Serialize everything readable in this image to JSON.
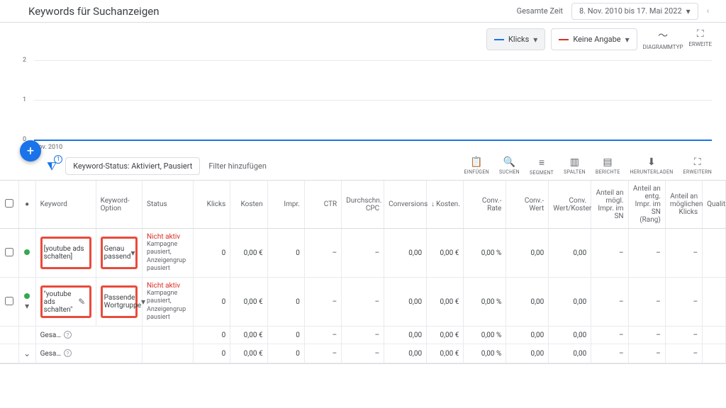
{
  "header": {
    "title": "Keywords für Suchanzeigen",
    "timeframe_label": "Gesamte Zeit",
    "daterange": "8. Nov. 2010 bis 17. Mai 2022"
  },
  "chart": {
    "series1_label": "Klicks",
    "series2_label": "Keine Angabe",
    "diagrammtyp": "DIAGRAMMTYP",
    "erweitern": "ERWEITE",
    "y": [
      "0",
      "1",
      "2"
    ],
    "x_start": "Nov. 2010"
  },
  "filters": {
    "badge": "1",
    "chip": "Keyword-Status: Aktiviert, Pausiert",
    "add": "Filter hinzufügen"
  },
  "tools": {
    "einfugen": "EINFÜGEN",
    "suchen": "SUCHEN",
    "segment": "SEGMENT",
    "spalten": "SPALTEN",
    "berichte": "BERICHTE",
    "herunterladen": "HERUNTERLADEN",
    "erweitern": "ERWEITERN"
  },
  "columns": [
    "Keyword",
    "Keyword-Option",
    "Status",
    "Klicks",
    "Kosten",
    "Impr.",
    "CTR",
    "Durchschn. CPC",
    "Conversions",
    "Kosten.",
    "Conv.-Rate",
    "Conv.-Wert",
    "Conv. Wert/Koster",
    "Anteil an mögl. Impr. im SN",
    "Anteil an entg. Impr. im SN (Rang)",
    "Anteil an möglichen Klicks",
    "Qualit"
  ],
  "rows": [
    {
      "kw": "[youtube ads schalten]",
      "opt": "Genau passend",
      "status_red": "Nicht aktiv",
      "status_sub": "Kampagne pausiert, Anzeigengrup pausiert",
      "klicks": "0",
      "kosten": "0,00 €",
      "impr": "0",
      "ctr": "–",
      "cpc": "–",
      "conv": "0,00",
      "kosten2": "0,00 €",
      "convrate": "0,00 %",
      "convwert": "0,00",
      "wertkosten": "0,00",
      "a1": "–",
      "a2": "–",
      "a3": "–",
      "edit": false
    },
    {
      "kw": "\"youtube ads schalten\"",
      "opt": "Passende Wortgruppe",
      "status_red": "Nicht aktiv",
      "status_sub": "Kampagne pausiert, Anzeigengrup pausiert",
      "klicks": "0",
      "kosten": "0,00 €",
      "impr": "0",
      "ctr": "–",
      "cpc": "–",
      "conv": "0,00",
      "kosten2": "0,00 €",
      "convrate": "0,00 %",
      "convwert": "0,00",
      "wertkosten": "0,00",
      "a1": "–",
      "a2": "–",
      "a3": "–",
      "edit": true
    }
  ],
  "totals": [
    {
      "label": "Gesa…",
      "klicks": "0",
      "kosten": "0,00 €",
      "impr": "0",
      "ctr": "–",
      "cpc": "–",
      "conv": "0,00",
      "kosten2": "0,00 €",
      "convrate": "0,00 %",
      "convwert": "0,00",
      "wertkosten": "0,00",
      "a1": "–",
      "a2": "–",
      "a3": "–"
    },
    {
      "label": "Gesa…",
      "klicks": "0",
      "kosten": "0,00 €",
      "impr": "0",
      "ctr": "–",
      "cpc": "–",
      "conv": "0,00",
      "kosten2": "0,00 €",
      "convrate": "0,00 %",
      "convwert": "0,00",
      "wertkosten": "0,00",
      "a1": "–",
      "a2": "–",
      "a3": "–"
    }
  ],
  "chart_data": {
    "type": "line",
    "title": "",
    "x_start": "Nov. 2010",
    "ylim": [
      0,
      2
    ],
    "series": [
      {
        "name": "Klicks",
        "color": "#1a73e8",
        "values": [
          0,
          0,
          0,
          0,
          0,
          0,
          0,
          0,
          0,
          0,
          0,
          0
        ]
      },
      {
        "name": "Keine Angabe",
        "color": "#d93025",
        "values": []
      }
    ]
  }
}
